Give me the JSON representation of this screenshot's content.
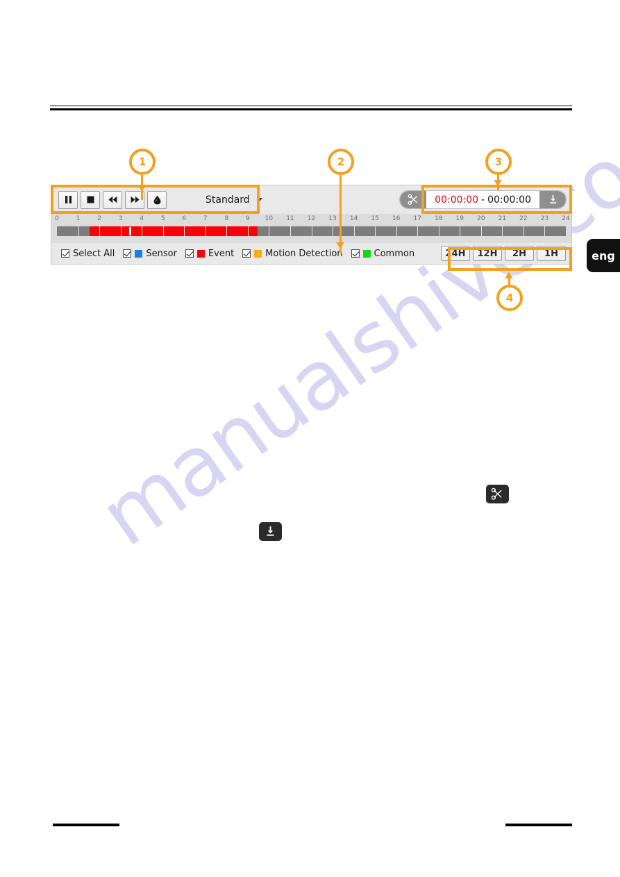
{
  "watermark": {
    "text": "manualshive.com"
  },
  "language_tab": {
    "label": "eng"
  },
  "toolbar": {
    "buttons": [
      {
        "name": "pause-button",
        "icon": "pause-icon"
      },
      {
        "name": "stop-button",
        "icon": "stop-icon"
      },
      {
        "name": "rewind-button",
        "icon": "rewind-icon"
      },
      {
        "name": "fast-forward-button",
        "icon": "fast-forward-icon"
      },
      {
        "name": "watermark-button",
        "icon": "water-drop-icon"
      }
    ],
    "quality": {
      "label": "Standard",
      "options": [
        "Standard"
      ],
      "icon": "chevron-down-icon"
    },
    "clip": {
      "scissors_icon": "scissors-icon",
      "download_icon": "download-icon",
      "time_start": "00:00:00",
      "separator": "-",
      "time_end": "00:00:00",
      "start_color": "#e8000c"
    }
  },
  "ruler": {
    "ticks": [
      "0",
      "1",
      "2",
      "3",
      "4",
      "5",
      "6",
      "7",
      "8",
      "9",
      "10",
      "11",
      "12",
      "13",
      "14",
      "15",
      "16",
      "17",
      "18",
      "19",
      "20",
      "21",
      "22",
      "23",
      "24"
    ],
    "min_hour": 0,
    "max_hour": 24
  },
  "timeline": {
    "base_color": "#7d7d7d",
    "cursor_hour": 3.4,
    "segments": [
      {
        "type": "Event",
        "color": "#fb0007",
        "start_hour": 1.55,
        "end_hour": 9.45
      }
    ]
  },
  "legend": {
    "items": [
      {
        "label": "Select All",
        "color": null,
        "checked": true
      },
      {
        "label": "Sensor",
        "color": "#1b7fe8",
        "checked": true
      },
      {
        "label": "Event",
        "color": "#fb0007",
        "checked": true
      },
      {
        "label": "Motion Detection",
        "color": "#f5ae17",
        "checked": true
      },
      {
        "label": "Common",
        "color": "#12d912",
        "checked": true
      }
    ]
  },
  "span_buttons": {
    "items": [
      {
        "label": "24H"
      },
      {
        "label": "12H"
      },
      {
        "label": "2H"
      },
      {
        "label": "1H"
      }
    ]
  },
  "callouts": [
    {
      "id": "1",
      "target": "transport-controls-group"
    },
    {
      "id": "2",
      "target": "timeline-bar"
    },
    {
      "id": "3",
      "target": "clip-time-group"
    },
    {
      "id": "4",
      "target": "span-buttons-group"
    }
  ],
  "body_icons": [
    {
      "name": "scissors-icon",
      "glyph": "scissors"
    },
    {
      "name": "download-icon",
      "glyph": "download"
    }
  ],
  "accent_color": "#f2a01e"
}
